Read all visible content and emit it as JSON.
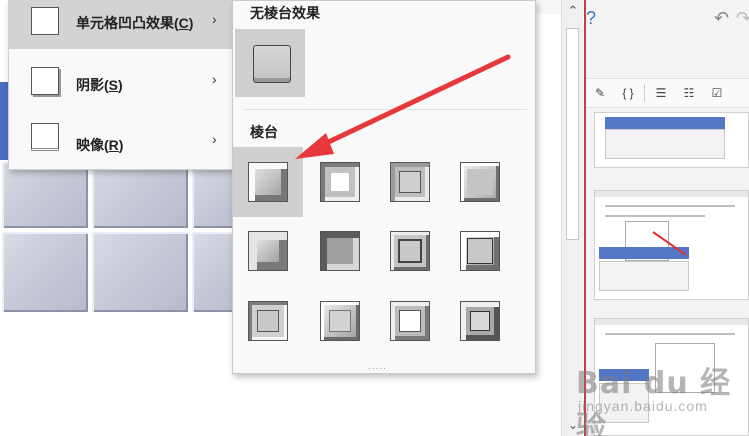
{
  "submenu": {
    "items": [
      {
        "label": "单元格凹凸效果",
        "accel": "C",
        "active": true
      },
      {
        "label": "阴影",
        "accel": "S",
        "active": false
      },
      {
        "label": "映像",
        "accel": "R",
        "active": false
      }
    ]
  },
  "gallery": {
    "no_bevel_heading": "无棱台效果",
    "bevel_heading": "棱台",
    "bevel_presets": [
      "circle",
      "relaxed-inset",
      "cross",
      "cool-slant",
      "angle",
      "soft-round",
      "convex",
      "slope",
      "divot",
      "riblet",
      "hard-edge",
      "art-deco"
    ],
    "selected_index": 0,
    "resize_handle": "....."
  },
  "right_pane": {
    "help_icon": "?",
    "undo_icon": "↶",
    "redo_icon": "↷",
    "toolbar_icons": [
      "pen-icon",
      "braces-icon",
      "bullet-list-icon",
      "numbered-list-icon",
      "checkbox-icon"
    ],
    "toolbar_glyphs": [
      "✎",
      "{ }",
      "☰",
      "☷",
      "☑"
    ]
  },
  "watermark": {
    "logo": "Bai du 经验",
    "sub": "jingyan.baidu.com"
  },
  "scrollbar": {
    "up": "⌃",
    "down": "⌄"
  },
  "colors": {
    "accent_blue": "#4a6cc4",
    "arrow_red": "#e8383d",
    "menu_bg": "#f9f9f9",
    "hover_bg": "#d3d3d3"
  }
}
